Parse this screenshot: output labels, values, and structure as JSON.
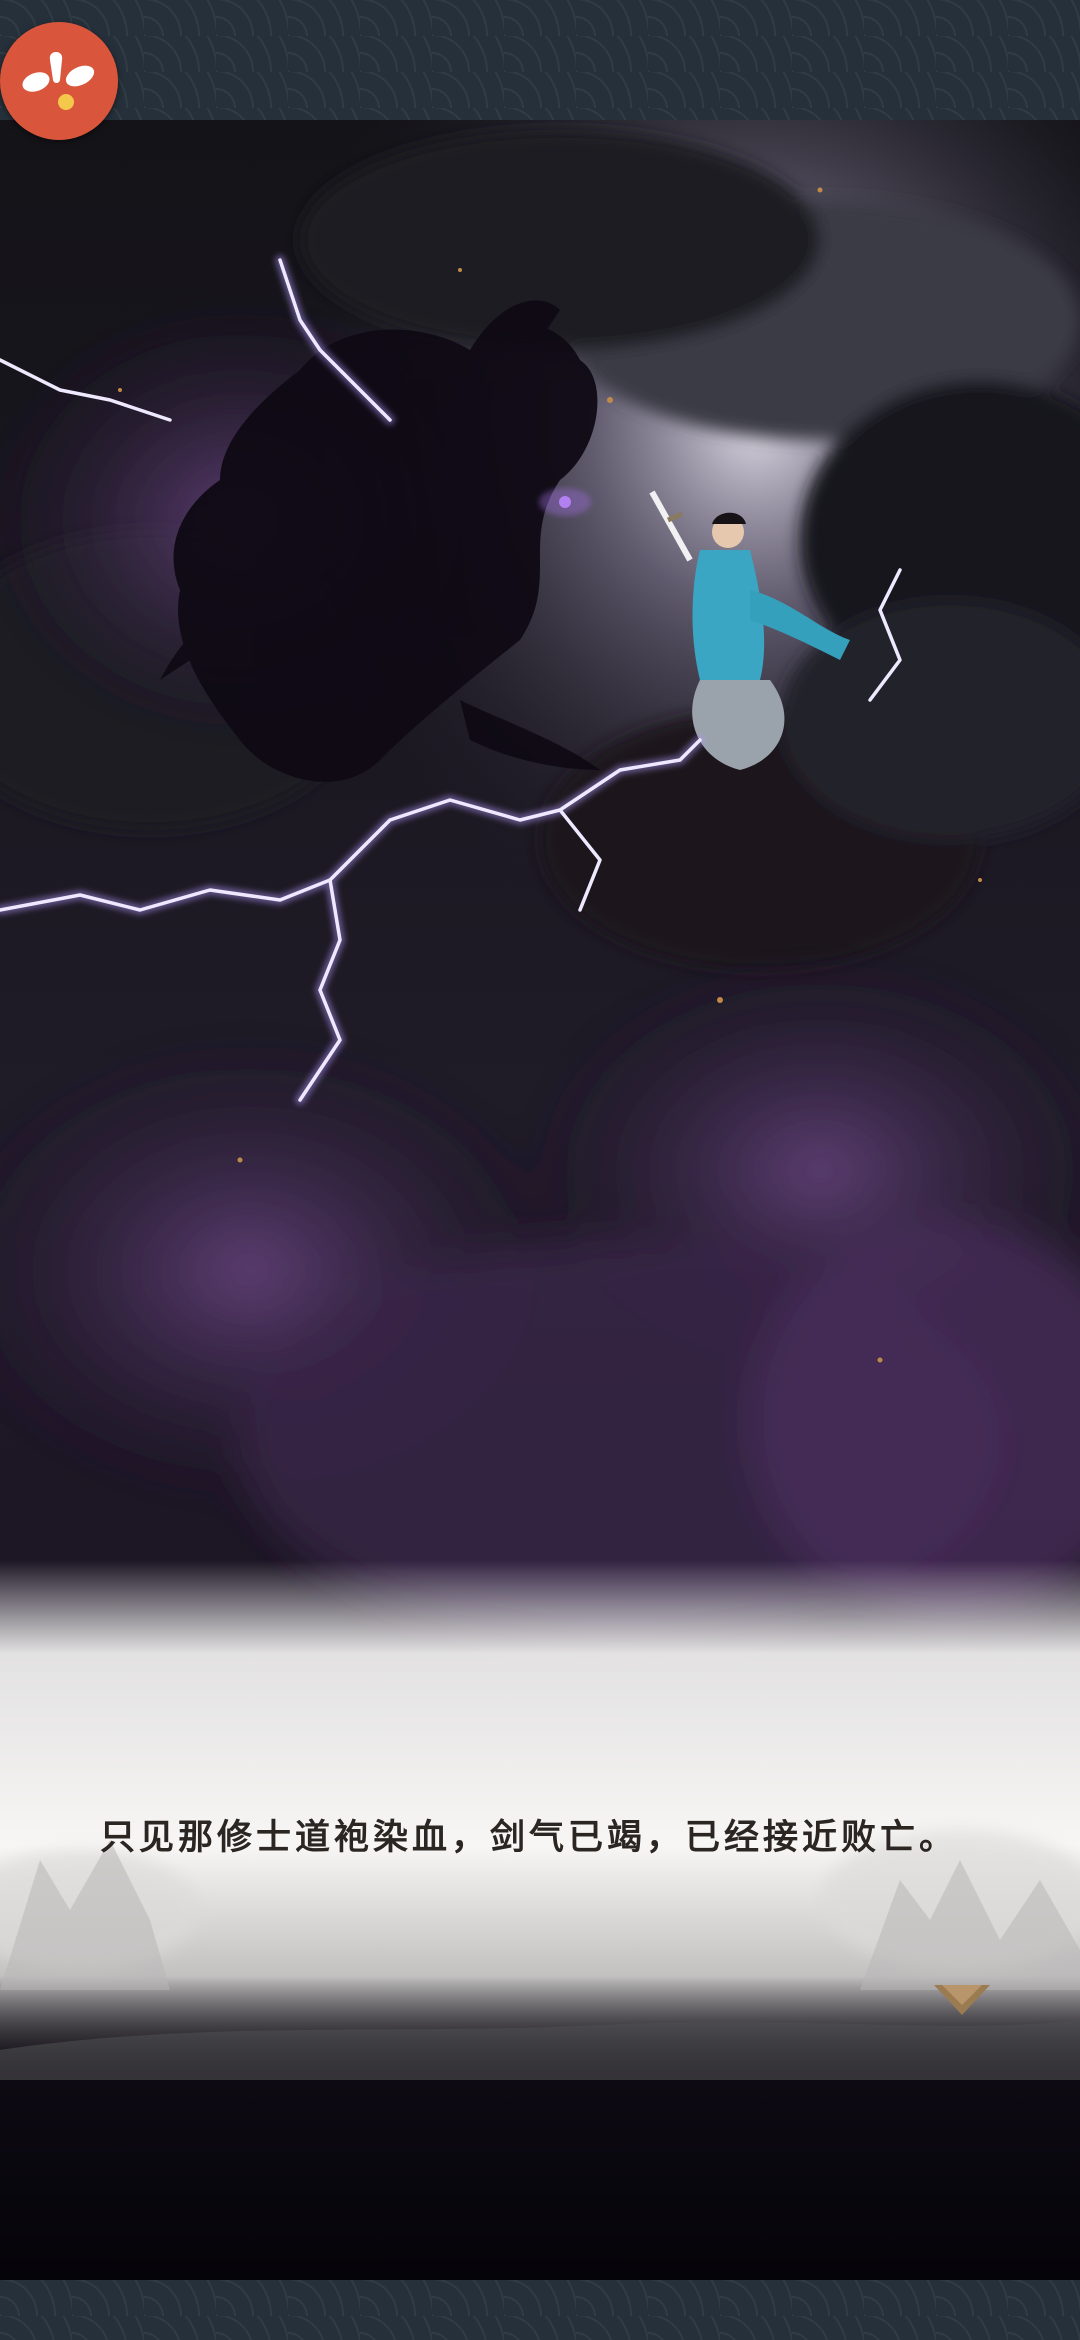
{
  "app": {
    "logo_icon": "app-logo-icon",
    "logo_color": "#d9563d"
  },
  "scene": {
    "illustration": "dragon-vs-swordsman-illustration",
    "palette": {
      "sky": "#0e0c14",
      "purple_cloud": "#4a2e5c",
      "lightning": "#c9b6ff",
      "robe": "#3aa6c4"
    }
  },
  "dialogue": {
    "text": "只见那修士道袍染血，剑气已竭，已经接近败亡。",
    "next_icon": "next-triangle-icon",
    "next_color": "#9a7b52"
  }
}
